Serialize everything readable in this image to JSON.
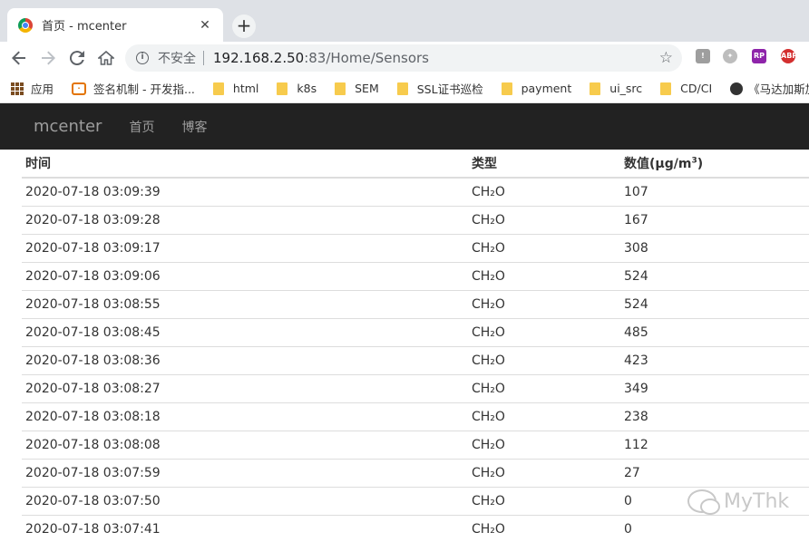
{
  "browser": {
    "tab_title": "首页 - mcenter",
    "tab_close": "✕",
    "new_tab": "+",
    "security_label": "不安全",
    "url_host": "192.168.2.50",
    "url_rest": ":83/Home/Sensors",
    "icons": [
      "back-icon",
      "forward-icon",
      "reload-icon",
      "home-icon",
      "info-icon",
      "star-icon"
    ]
  },
  "bookmarks": [
    {
      "label": "应用",
      "icon": "apps-icon"
    },
    {
      "label": "签名机制 - 开发指...",
      "icon": "brand-icon"
    },
    {
      "label": "html",
      "icon": "folder-icon"
    },
    {
      "label": "k8s",
      "icon": "folder-icon"
    },
    {
      "label": "SEM",
      "icon": "folder-icon"
    },
    {
      "label": "SSL证书巡检",
      "icon": "folder-icon"
    },
    {
      "label": "payment",
      "icon": "folder-icon"
    },
    {
      "label": "ui_src",
      "icon": "folder-icon"
    },
    {
      "label": "CD/CI",
      "icon": "folder-icon"
    },
    {
      "label": "《马达加斯加的企",
      "icon": "globe-icon"
    }
  ],
  "navbar": {
    "brand": "mcenter",
    "links": [
      "首页",
      "博客"
    ]
  },
  "table": {
    "headers": {
      "time": "时间",
      "type": "类型",
      "value": "数值(μg/m",
      "value_sup": "3",
      "value_close": ")"
    },
    "rows": [
      {
        "time": "2020-07-18 03:09:39",
        "type": "CH₂O",
        "value": "107"
      },
      {
        "time": "2020-07-18 03:09:28",
        "type": "CH₂O",
        "value": "167"
      },
      {
        "time": "2020-07-18 03:09:17",
        "type": "CH₂O",
        "value": "308"
      },
      {
        "time": "2020-07-18 03:09:06",
        "type": "CH₂O",
        "value": "524"
      },
      {
        "time": "2020-07-18 03:08:55",
        "type": "CH₂O",
        "value": "524"
      },
      {
        "time": "2020-07-18 03:08:45",
        "type": "CH₂O",
        "value": "485"
      },
      {
        "time": "2020-07-18 03:08:36",
        "type": "CH₂O",
        "value": "423"
      },
      {
        "time": "2020-07-18 03:08:27",
        "type": "CH₂O",
        "value": "349"
      },
      {
        "time": "2020-07-18 03:08:18",
        "type": "CH₂O",
        "value": "238"
      },
      {
        "time": "2020-07-18 03:08:08",
        "type": "CH₂O",
        "value": "112"
      },
      {
        "time": "2020-07-18 03:07:59",
        "type": "CH₂O",
        "value": "27"
      },
      {
        "time": "2020-07-18 03:07:50",
        "type": "CH₂O",
        "value": "0"
      },
      {
        "time": "2020-07-18 03:07:41",
        "type": "CH₂O",
        "value": "0"
      }
    ]
  },
  "watermark": {
    "text": "MyThk"
  }
}
